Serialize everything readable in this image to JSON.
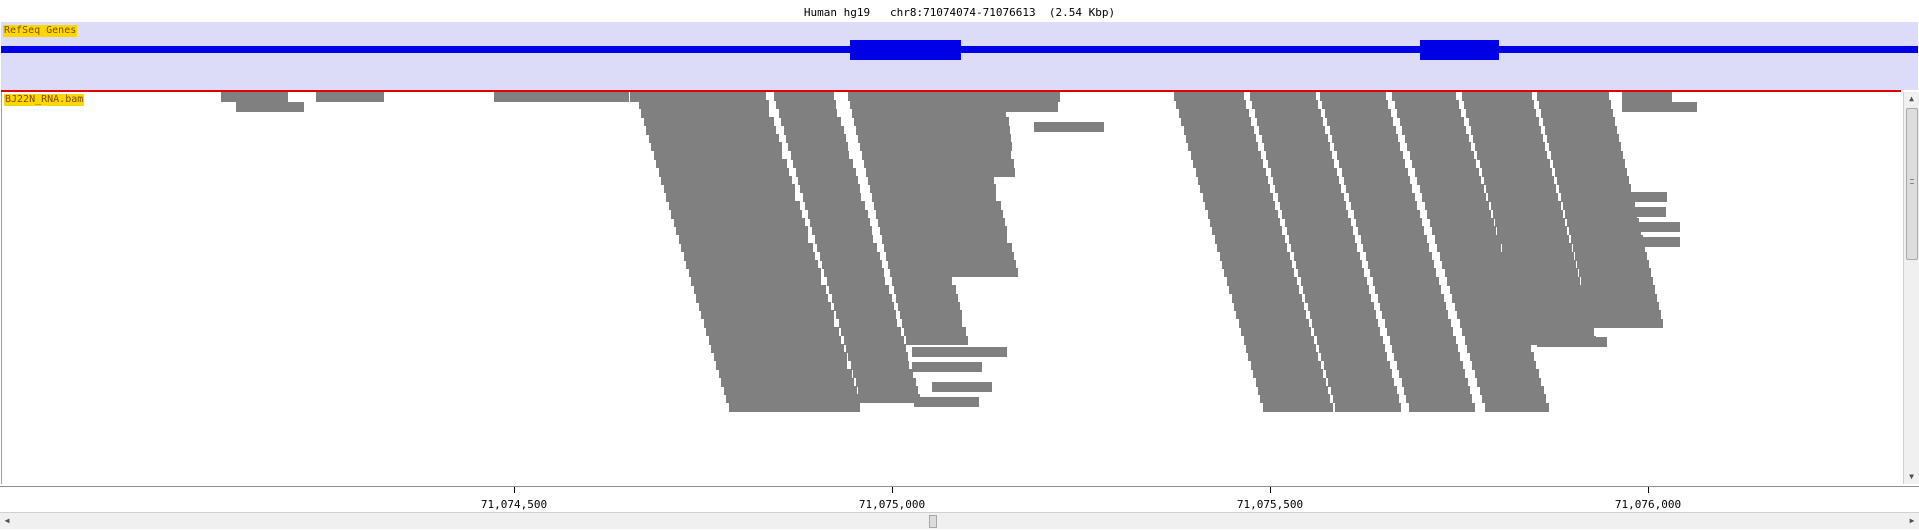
{
  "locus": {
    "genome": "Human hg19",
    "region": "chr8:71074074-71076613",
    "span": "(2.54 Kbp)"
  },
  "tracks": {
    "gene_track_label": "RefSeq Genes",
    "bam_track_label": "BJ22N_RNA.bam"
  },
  "ruler": {
    "ticks": [
      "71,074,500",
      "71,075,000",
      "71,075,500",
      "71,076,000"
    ]
  },
  "colors": {
    "gene": "#0000e6",
    "gene_track_bg": "#dcdcf8",
    "read": "#808080",
    "separator": "#e00000",
    "label_bg": "#ffd700"
  },
  "icons": {
    "scroll_up": "triangle-up-icon",
    "scroll_down": "triangle-down-icon",
    "scroll_left": "triangle-left-icon",
    "scroll_right": "triangle-right-icon"
  }
}
